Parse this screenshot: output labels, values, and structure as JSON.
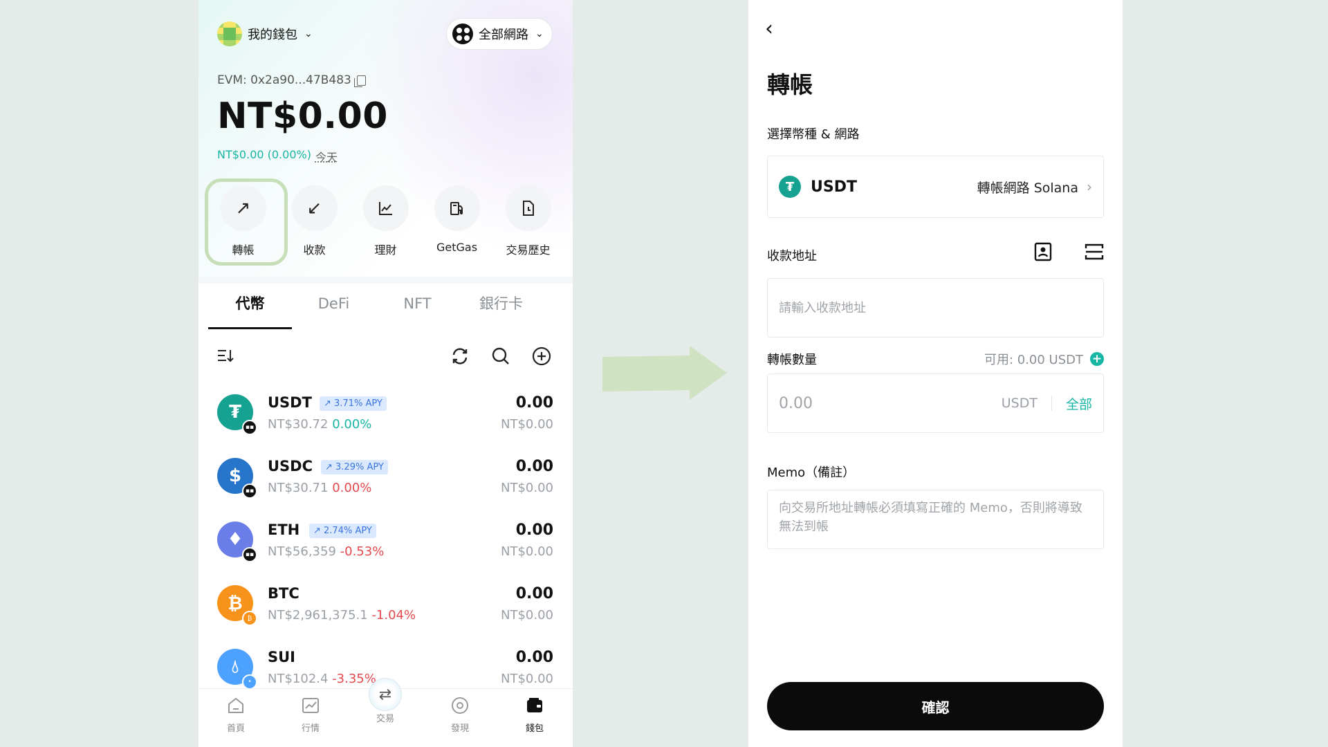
{
  "left_screen": {
    "wallet_name": "我的錢包",
    "network_selector": "全部網路",
    "evm_address": "EVM: 0x2a90...47B483",
    "total_balance": "NT$0.00",
    "balance_change": "NT$0.00 (0.00%)",
    "change_period": "今天",
    "actions": [
      {
        "label": "轉帳",
        "icon": "arrow-up-right-icon",
        "highlighted": true
      },
      {
        "label": "收款",
        "icon": "arrow-down-left-icon"
      },
      {
        "label": "理財",
        "icon": "chart-line-icon"
      },
      {
        "label": "GetGas",
        "icon": "gas-station-icon"
      },
      {
        "label": "交易歷史",
        "icon": "document-icon"
      }
    ],
    "tabs": [
      "代幣",
      "DeFi",
      "NFT",
      "銀行卡"
    ],
    "active_tab": "代幣",
    "tokens": [
      {
        "symbol": "USDT",
        "apy": "3.71% APY",
        "price": "NT$30.72",
        "change": "0.00%",
        "trend": "up",
        "amount": "0.00",
        "fiat": "NT$0.00",
        "color": "#16a291"
      },
      {
        "symbol": "USDC",
        "apy": "3.29% APY",
        "price": "NT$30.71",
        "change": "0.00%",
        "trend": "down",
        "amount": "0.00",
        "fiat": "NT$0.00",
        "color": "#2775ca"
      },
      {
        "symbol": "ETH",
        "apy": "2.74% APY",
        "price": "NT$56,359",
        "change": "-0.53%",
        "trend": "down",
        "amount": "0.00",
        "fiat": "NT$0.00",
        "color": "#6b7de8"
      },
      {
        "symbol": "BTC",
        "apy": "",
        "price": "NT$2,961,375.1",
        "change": "-1.04%",
        "trend": "down",
        "amount": "0.00",
        "fiat": "NT$0.00",
        "color": "#f7931a"
      },
      {
        "symbol": "SUI",
        "apy": "",
        "price": "NT$102.4",
        "change": "-3.35%",
        "trend": "down",
        "amount": "0.00",
        "fiat": "NT$0.00",
        "color": "#4da2ff"
      }
    ],
    "bottom_nav": [
      {
        "label": "首頁",
        "icon": "home-icon"
      },
      {
        "label": "行情",
        "icon": "market-chart-icon"
      },
      {
        "label": "交易",
        "icon": "swap-icon"
      },
      {
        "label": "發現",
        "icon": "discover-icon"
      },
      {
        "label": "錢包",
        "icon": "wallet-icon",
        "active": true
      }
    ]
  },
  "right_screen": {
    "title": "轉帳",
    "select_label": "選擇幣種 & 網路",
    "coin": "USDT",
    "network_text": "轉帳網路 Solana",
    "address_label": "收款地址",
    "address_placeholder": "請輸入收款地址",
    "amount_label": "轉帳數量",
    "available": "可用: 0.00 USDT",
    "amount_value": "0.00",
    "amount_unit": "USDT",
    "amount_all": "全部",
    "memo_label": "Memo（備註）",
    "memo_placeholder": "向交易所地址轉帳必須填寫正確的 Memo，否則將導致無法到帳",
    "confirm_label": "確認"
  },
  "colors": {
    "accent_teal": "#17b5a3",
    "negative_red": "#e5484d",
    "apy_blue": "#3a74e0",
    "highlight_green": "#c7dfb9",
    "arrow_green": "#cfe3c2"
  }
}
